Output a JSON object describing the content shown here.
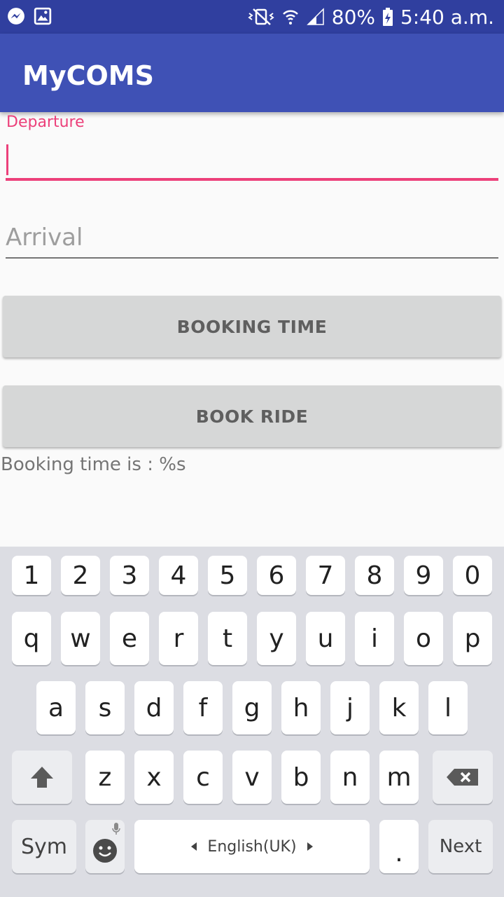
{
  "status_bar": {
    "battery": "80%",
    "time": "5:40 a.m."
  },
  "app": {
    "title": "MyCOMS"
  },
  "form": {
    "departure_label": "Departure",
    "departure_value": "",
    "arrival_placeholder": "Arrival",
    "arrival_value": ""
  },
  "buttons": {
    "booking_time": "BOOKING TIME",
    "book_ride": "BOOK RIDE"
  },
  "booking_text": "Booking time is : %s",
  "colors": {
    "primary": "#3f51b5",
    "primary_dark": "#303f9f",
    "accent": "#ec407a",
    "button_bg": "#d6d7d7"
  },
  "keyboard": {
    "numbers": [
      "1",
      "2",
      "3",
      "4",
      "5",
      "6",
      "7",
      "8",
      "9",
      "0"
    ],
    "row1": [
      "q",
      "w",
      "e",
      "r",
      "t",
      "y",
      "u",
      "i",
      "o",
      "p"
    ],
    "row2": [
      "a",
      "s",
      "d",
      "f",
      "g",
      "h",
      "j",
      "k",
      "l"
    ],
    "row3": [
      "z",
      "x",
      "c",
      "v",
      "b",
      "n",
      "m"
    ],
    "sym": "Sym",
    "language": "English(UK)",
    "period": ".",
    "next": "Next",
    "icons": [
      "shift-icon",
      "backspace-icon",
      "emoji-icon",
      "mic-icon",
      "arrow-left-icon",
      "arrow-right-icon"
    ]
  }
}
